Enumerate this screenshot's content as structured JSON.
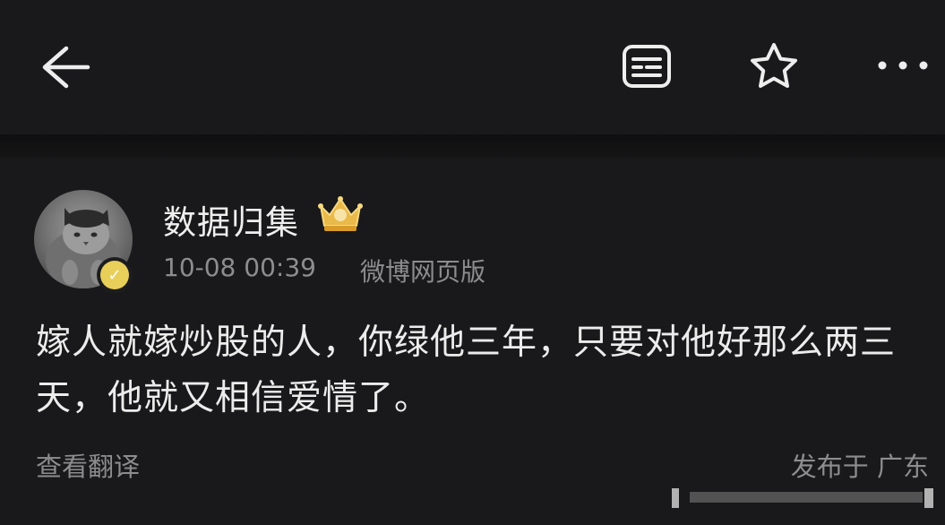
{
  "header": {
    "back_icon": "arrow-left-icon",
    "reader_icon": "reader-mode-icon",
    "favorite_icon": "star-icon",
    "more_icon": "more-dots-icon"
  },
  "post": {
    "username": "数据归集",
    "badge_icon": "crown-icon",
    "verified_icon": "verified-badge-icon",
    "time": "10-08 00:39",
    "source": "微博网页版",
    "text": "嫁人就嫁炒股的人，你绿他三年，只要对他好那么两三天，他就又相信爱情了。",
    "translate_label": "查看翻译",
    "location": "发布于 广东"
  },
  "colors": {
    "background": "#19191b",
    "text_primary": "#ececec",
    "text_secondary": "#8d8d90",
    "verified": "#e8cf5a"
  }
}
